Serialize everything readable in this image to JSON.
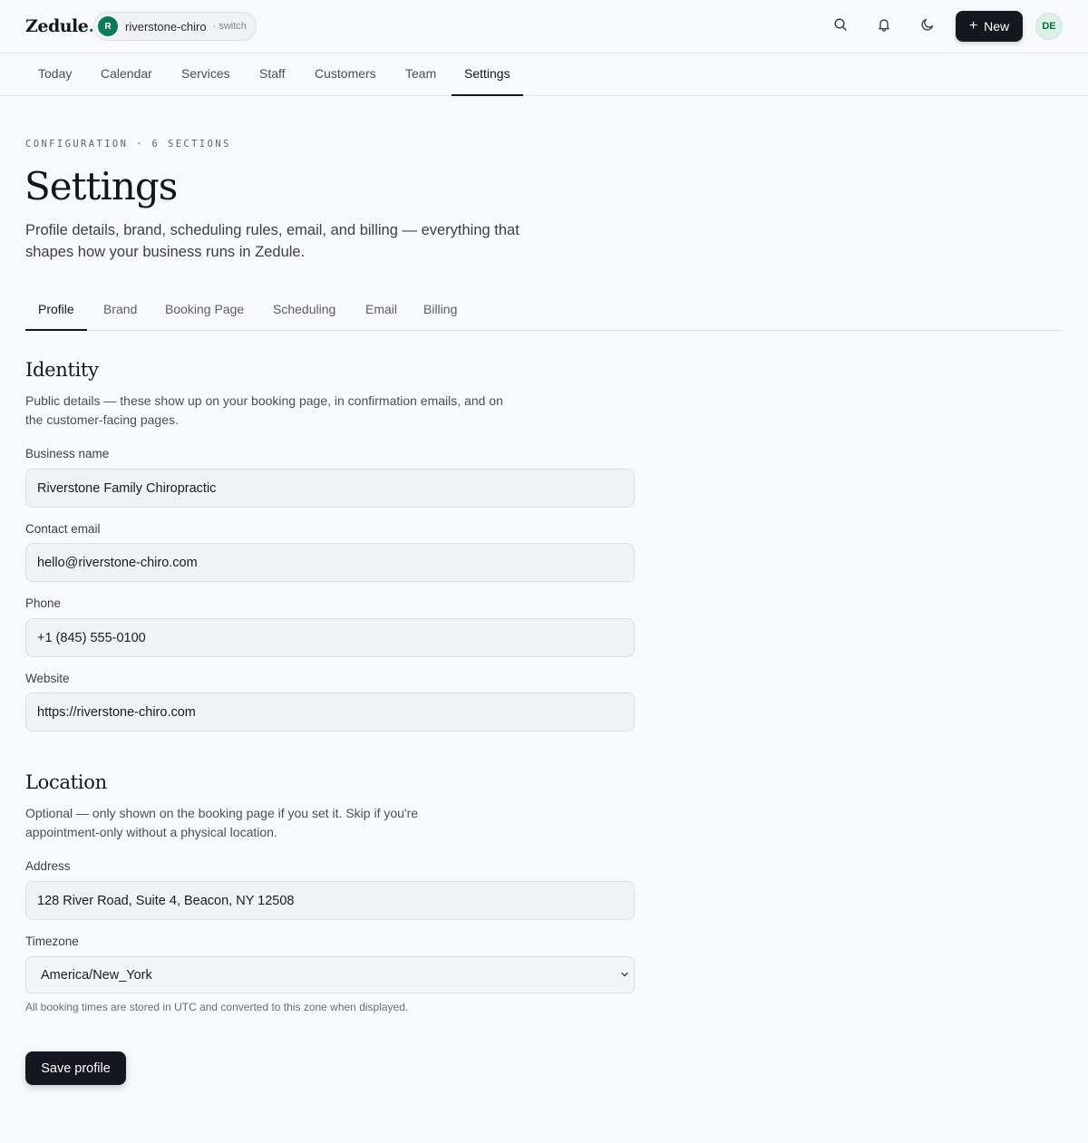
{
  "app": {
    "logo": "Zedule",
    "logo_dot": ".",
    "workspace": {
      "avatar_letter": "R",
      "name": "riverstone-chiro",
      "switch_label": "· switch"
    },
    "new_button_label": "New",
    "user_initials": "DE",
    "icons": [
      "search-icon",
      "bell-icon",
      "moon-icon",
      "plus-icon"
    ]
  },
  "main_nav": {
    "items": [
      {
        "label": "Today"
      },
      {
        "label": "Calendar"
      },
      {
        "label": "Services"
      },
      {
        "label": "Staff"
      },
      {
        "label": "Customers"
      },
      {
        "label": "Team"
      },
      {
        "label": "Settings"
      }
    ],
    "active": "Settings"
  },
  "header": {
    "eyebrow": "CONFIGURATION · 6 SECTIONS",
    "title": "Settings",
    "description": "Profile details, brand, scheduling rules, email, and billing — everything that shapes how your business runs in Zedule."
  },
  "tabs": {
    "items": [
      {
        "label": "Profile"
      },
      {
        "label": "Brand"
      },
      {
        "label": "Booking Page"
      },
      {
        "label": "Scheduling"
      },
      {
        "label": "Email"
      },
      {
        "label": "Billing"
      }
    ],
    "active": "Profile"
  },
  "identity": {
    "title": "Identity",
    "description": "Public details — these show up on your booking page, in confirmation emails, and on the customer-facing pages.",
    "fields": [
      {
        "label": "Business name",
        "value": "Riverstone Family Chiropractic"
      },
      {
        "label": "Contact email",
        "value": "hello@riverstone-chiro.com"
      },
      {
        "label": "Phone",
        "value": "+1 (845) 555-0100"
      },
      {
        "label": "Website",
        "value": "https://riverstone-chiro.com"
      }
    ]
  },
  "location": {
    "title": "Location",
    "description": "Optional — only shown on the booking page if you set it. Skip if you're appointment-only without a physical location.",
    "address": {
      "label": "Address",
      "value": "128 River Road, Suite 4, Beacon, NY 12508"
    },
    "timezone": {
      "label": "Timezone",
      "value": "America/New_York",
      "helper": "All booking times are stored in UTC and converted to this zone when displayed."
    }
  },
  "save_button_label": "Save profile",
  "colors": {
    "background": "#f8f9fc",
    "primary_button": "#15161f",
    "brand_green": "#0f7a57",
    "avatar_bg": "#dcf1e6"
  }
}
